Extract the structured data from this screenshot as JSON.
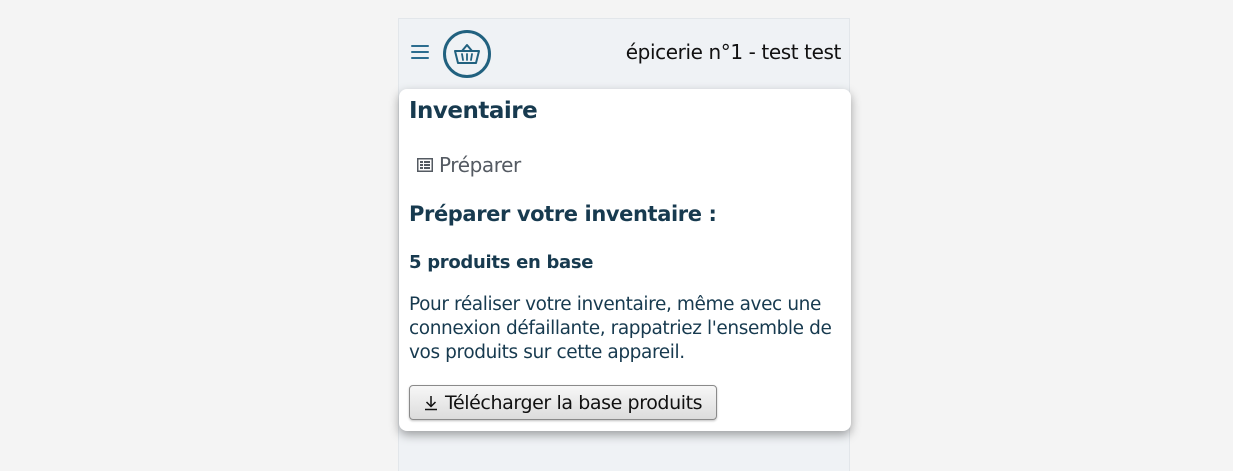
{
  "header": {
    "shop_name": "épicerie n°1 - test test",
    "menu_icon": "hamburger-menu-icon",
    "logo_icon": "shopping-basket-icon",
    "accent_color": "#21617f"
  },
  "card": {
    "title": "Inventaire",
    "breadcrumb": {
      "icon": "list-form-icon",
      "label": "Préparer"
    },
    "section_title": "Préparer votre inventaire :",
    "product_count": "5 produits en base",
    "description": "Pour réaliser votre inventaire, même avec une connexion défaillante, rappatriez l'ensemble de vos produits sur cette appareil.",
    "download_button": {
      "icon": "download-icon",
      "label": "Télécharger la base produits"
    }
  },
  "colors": {
    "heading": "#173a4f",
    "background": "#eff2f5",
    "page_background": "#f4f4f4"
  }
}
